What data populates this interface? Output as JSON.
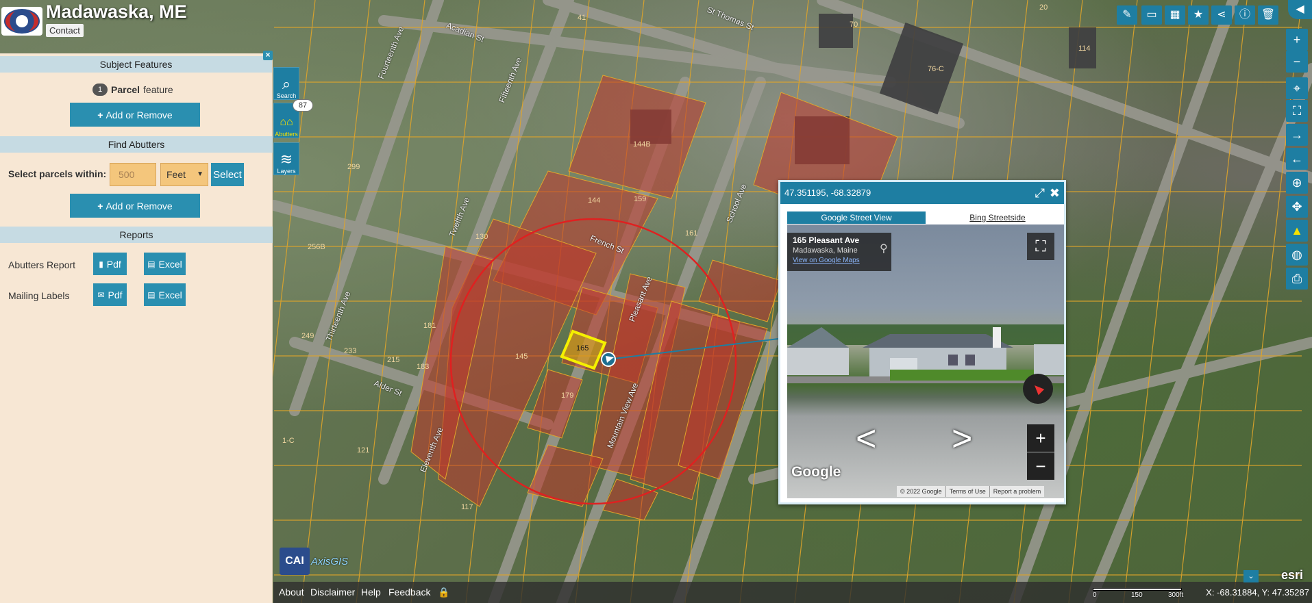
{
  "header": {
    "town_title": "Madawaska, ME",
    "contact_label": "Contact"
  },
  "panel": {
    "subject_features": {
      "heading": "Subject Features",
      "count": "1",
      "feature_type": "Parcel",
      "feature_suffix": "feature",
      "add_remove_label": "Add or Remove"
    },
    "find_abutters": {
      "heading": "Find Abutters",
      "within_label": "Select parcels within:",
      "distance_value": "500",
      "unit_value": "Feet",
      "select_label": "Select",
      "add_remove_label": "Add or Remove"
    },
    "reports": {
      "heading": "Reports",
      "abutters_label": "Abutters Report",
      "mailing_label": "Mailing Labels",
      "pdf_label": "Pdf",
      "excel_label": "Excel"
    }
  },
  "vtools": {
    "search_label": "Search",
    "abutters_label": "Abutters",
    "abutters_count": "87",
    "layers_label": "Layers"
  },
  "map": {
    "street_labels": [
      "French St",
      "Pleasant Ave",
      "Mountain View Ave",
      "School Ave",
      "Eleventh Ave",
      "Twelfth Ave",
      "Thirteenth Ave",
      "Fourteenth Ave",
      "Fifteenth Ave",
      "Alder St",
      "Acadian St",
      "St Thomas St"
    ],
    "parcel_labels": [
      "145",
      "144",
      "144B",
      "76-C",
      "70",
      "114",
      "20",
      "41",
      "130",
      "159",
      "161",
      "165",
      "179",
      "181",
      "183",
      "215",
      "233",
      "249",
      "256B",
      "299",
      "1-C",
      "121",
      "117"
    ],
    "selected_parcel_label": "165"
  },
  "popup": {
    "coords": "47.351195, -68.32879",
    "tab_google": "Google Street View",
    "tab_bing": "Bing Streetside",
    "address": "165 Pleasant Ave",
    "city": "Madawaska, Maine",
    "view_on_google": "View on Google Maps",
    "watermark": "Google",
    "footer": [
      "© 2022 Google",
      "Terms of Use",
      "Report a problem"
    ]
  },
  "bottom": {
    "links": [
      "About",
      "Disclaimer",
      "Help",
      "Feedback"
    ],
    "coords": "X: -68.31884, Y: 47.35287",
    "scale_labels": [
      "0",
      "150",
      "300ft"
    ],
    "esri": "esri",
    "cai_box": "CAI",
    "cai_text": "AxisGIS"
  },
  "colors": {
    "accent": "#1e7ea2",
    "panel_bg": "#f7e7d4",
    "section_head": "#c6dbe3",
    "input_bg": "#f4c67c",
    "abutter_fill": "#c0392b",
    "buffer_circle": "#e02020",
    "selected_parcel": "#f5f000"
  },
  "icons": {
    "top_toolbar": [
      "pencil-icon",
      "ruler-icon",
      "grid-icon",
      "star-icon",
      "share-icon",
      "info-icon",
      "trash-icon",
      "back-arrow-icon"
    ],
    "right_toolbar": [
      "zoom-in-icon",
      "zoom-out-icon",
      "locate-icon",
      "full-extent-icon",
      "next-extent-icon",
      "previous-extent-icon",
      "zoom-box-icon",
      "pan-icon",
      "street-view-icon",
      "globe-icon",
      "print-icon"
    ]
  }
}
